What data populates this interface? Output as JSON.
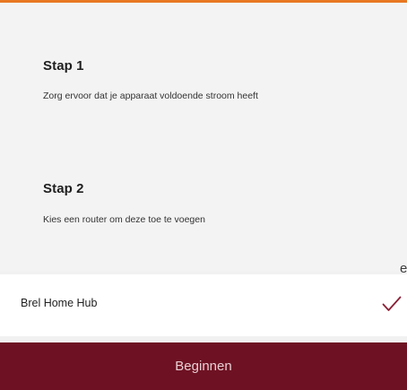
{
  "colors": {
    "accent_top": "#e87722",
    "brand": "#6e1223",
    "check": "#8a1f35",
    "background": "#f3f3f3"
  },
  "steps": [
    {
      "title": "Stap 1",
      "description": "Zorg ervoor dat je apparaat voldoende stroom heeft"
    },
    {
      "title": "Stap 2",
      "description": "Kies een router om deze toe te voegen"
    }
  ],
  "edge_fragment": "e",
  "router_list": {
    "items": [
      {
        "label": "Brel Home Hub",
        "selected": true,
        "icon": "checkmark-icon"
      }
    ]
  },
  "footer": {
    "begin_label": "Beginnen"
  }
}
